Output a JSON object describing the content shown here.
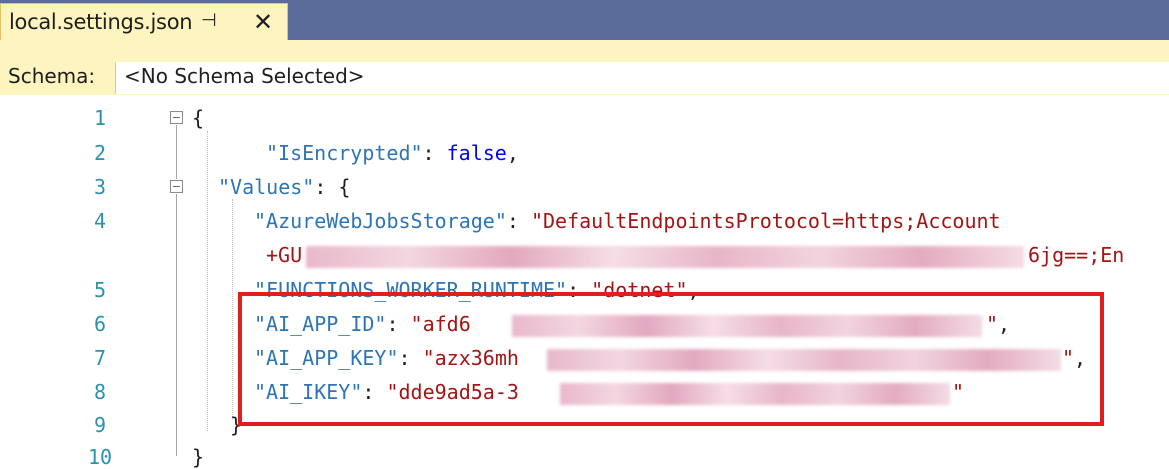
{
  "tab": {
    "title": "local.settings.json",
    "pin_icon": "pin-icon",
    "close_icon": "close-icon"
  },
  "schema": {
    "label": "Schema:",
    "value": "<No Schema Selected>"
  },
  "line_numbers": [
    "1",
    "2",
    "3",
    "4",
    "5",
    "6",
    "7",
    "8",
    "9",
    "10"
  ],
  "code": {
    "l1": "{",
    "l2_key": "\"IsEncrypted\"",
    "l2_sep": ": ",
    "l2_val": "false",
    "l2_end": ",",
    "l3_key": "\"Values\"",
    "l3_rest": ": {",
    "l4_key": "\"AzureWebJobsStorage\"",
    "l4_sep": ": ",
    "l4_val": "\"DefaultEndpointsProtocol=https;Account",
    "l4b_start": "+GU",
    "l4b_end": "6jg==;En",
    "l5_key": "\"FUNCTIONS_WORKER_RUNTIME\"",
    "l5_sep": ": ",
    "l5_val": "\"dotnet\"",
    "l5_end": ",",
    "l6_key": "\"AI_APP_ID\"",
    "l6_sep": ": ",
    "l6_val": "\"afd6",
    "l6_tail": "\"",
    "l6_end": ",",
    "l7_key": "\"AI_APP_KEY\"",
    "l7_sep": ": ",
    "l7_val": "\"azx36mh",
    "l7_tail": "\"",
    "l7_end": ",",
    "l8_key": "\"AI_IKEY\"",
    "l8_sep": ": ",
    "l8_val": "\"dde9ad5a-3",
    "l8_tail": "\"",
    "l9": "}",
    "l10": "}"
  },
  "colors": {
    "tabbar": "#5b6b9a",
    "tab": "#fdf4bf",
    "line_number": "#2b91af",
    "key": "#2e75b6",
    "string": "#a31515",
    "keyword": "#0000ff",
    "highlight": "#e01e1e"
  }
}
